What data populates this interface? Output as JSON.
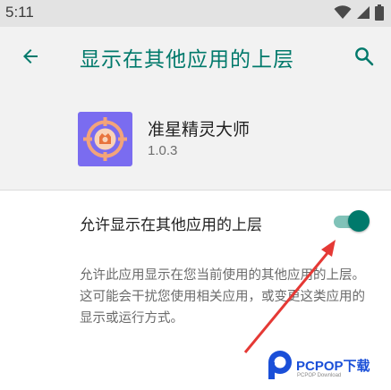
{
  "status_bar": {
    "time": "5:11",
    "icons": [
      "wifi-icon",
      "signal-icon",
      "battery-icon"
    ]
  },
  "app_bar": {
    "title": "显示在其他应用的上层",
    "back_icon": "arrow-left-icon",
    "search_icon": "search-icon"
  },
  "app_info": {
    "name": "准星精灵大师",
    "version": "1.0.3",
    "icon": "crosshair-app-icon"
  },
  "setting": {
    "label": "允许显示在其他应用的上层",
    "enabled": true
  },
  "description": "允许此应用显示在您当前使用的其他应用的上层。这可能会干扰您使用相关应用，或变更这类应用的显示或运行方式。",
  "watermark": {
    "text": "PCPOP下载",
    "sub": "PCPOP Download"
  },
  "colors": {
    "accent": "#00796b",
    "track": "#80c2b8",
    "app_icon_bg": "#7a6cf0",
    "annotation_arrow": "#e53935"
  }
}
